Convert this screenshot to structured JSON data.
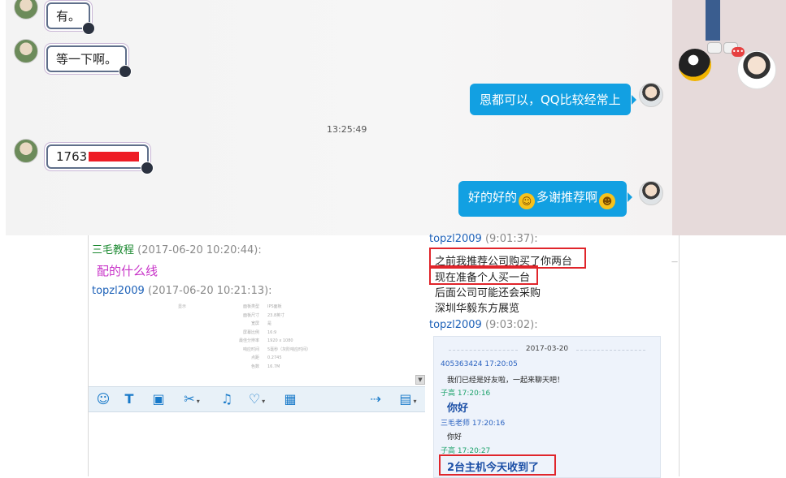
{
  "chat": {
    "msg_you": "有。",
    "msg_wait": "等一下啊。",
    "msg_right1": "恩都可以，QQ比较经常上",
    "timestamp": "13:25:49",
    "msg_number": "1763",
    "msg_right2_a": "好的好的",
    "msg_right2_b": "多谢推荐啊",
    "emoji_1": "face-emoji",
    "emoji_2": "grin-emoji",
    "side_badge": "•••"
  },
  "left_panel": {
    "sender1": "三毛教程",
    "time1": "(2017-06-20 10:20:44):",
    "msg1": "配的什么线",
    "sender2": "topzl2009",
    "time2": "(2017-06-20 10:21:13):",
    "spec_rows": [
      {
        "k": "显示",
        "k2": "面板类型",
        "v": "IPS面板"
      },
      {
        "k": "",
        "k2": "面板尺寸",
        "v": "23.8英寸"
      },
      {
        "k": "",
        "k2": "宽屏",
        "v": "是"
      },
      {
        "k": "",
        "k2": "屏幕比例",
        "v": "16:9"
      },
      {
        "k": "",
        "k2": "最佳分辨率",
        "v": "1920 x 1080"
      },
      {
        "k": "",
        "k2": "响应时间",
        "v": "5毫秒（灰阶响应时间）"
      },
      {
        "k": "",
        "k2": "点距",
        "v": "0.2745"
      },
      {
        "k": "",
        "k2": "色数",
        "v": "16.7M"
      }
    ],
    "toolbar": {
      "emoji": "☺",
      "font": "T",
      "image": "▣",
      "scissors": "✂",
      "shake": "♫",
      "heart": "♡",
      "screenshot": "▦",
      "forward": "⇢",
      "record": "▤",
      "caret": "▾"
    }
  },
  "right_panel": {
    "sender_a": "topzl2009",
    "time_a": "(9:01:37):",
    "lines": [
      "之前我推荐公司购买了你两台",
      "现在准备个人买一台",
      "后面公司可能还会采购",
      "深圳华毅东方展览"
    ],
    "sender_b": "topzl2009",
    "time_b": "(9:03:02):",
    "record": {
      "date": "2017-03-20",
      "e1_name": "405363424 17:20:05",
      "e1_msg": "我们已经是好友啦，一起来聊天吧！",
      "e2_name": "子高 17:20:16",
      "e2_msg": "你好",
      "e3_name": "三毛老师 17:20:16",
      "e3_msg": "你好",
      "e4_name": "子高 17:20:27",
      "e4_msg": "2台主机今天收到了"
    }
  }
}
